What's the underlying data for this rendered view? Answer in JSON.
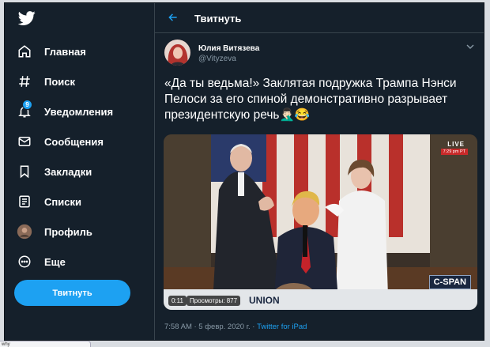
{
  "sidebar": {
    "logo_icon": "twitter-bird-icon",
    "items": [
      {
        "label": "Главная",
        "icon": "home-icon"
      },
      {
        "label": "Поиск",
        "icon": "hashtag-icon"
      },
      {
        "label": "Уведомления",
        "icon": "bell-icon",
        "badge": "9"
      },
      {
        "label": "Сообщения",
        "icon": "envelope-icon"
      },
      {
        "label": "Закладки",
        "icon": "bookmark-icon"
      },
      {
        "label": "Списки",
        "icon": "list-icon"
      },
      {
        "label": "Профиль",
        "icon": "avatar-icon"
      },
      {
        "label": "Еще",
        "icon": "more-icon"
      }
    ],
    "tweet_button": "Твитнуть"
  },
  "header": {
    "title": "Твитнуть",
    "back_icon": "back-arrow-icon"
  },
  "tweet": {
    "author_name": "Юлия Витязева",
    "author_handle": "@Vityzeva",
    "text": "«Да ты ведьма!» Заклятая подружка Трампа Нэнси Пелоси за его спиной демонстративно разрывает президентскую речь🤦🏻‍♂️😂",
    "media": {
      "live_label": "LIVE",
      "live_time": "7:29 pm PT",
      "network_logo": "C-SPAN",
      "banner_text": "UNION",
      "duration": "0:11",
      "views": "Просмотры: 877"
    },
    "timestamp": "7:58 AM · 5 февр. 2020 г. · ",
    "source": "Twitter for iPad"
  },
  "colors": {
    "background": "#15202b",
    "accent": "#1da1f2",
    "text": "#ffffff",
    "muted": "#8899a6",
    "border": "#38444d"
  },
  "footer_stub": "why"
}
